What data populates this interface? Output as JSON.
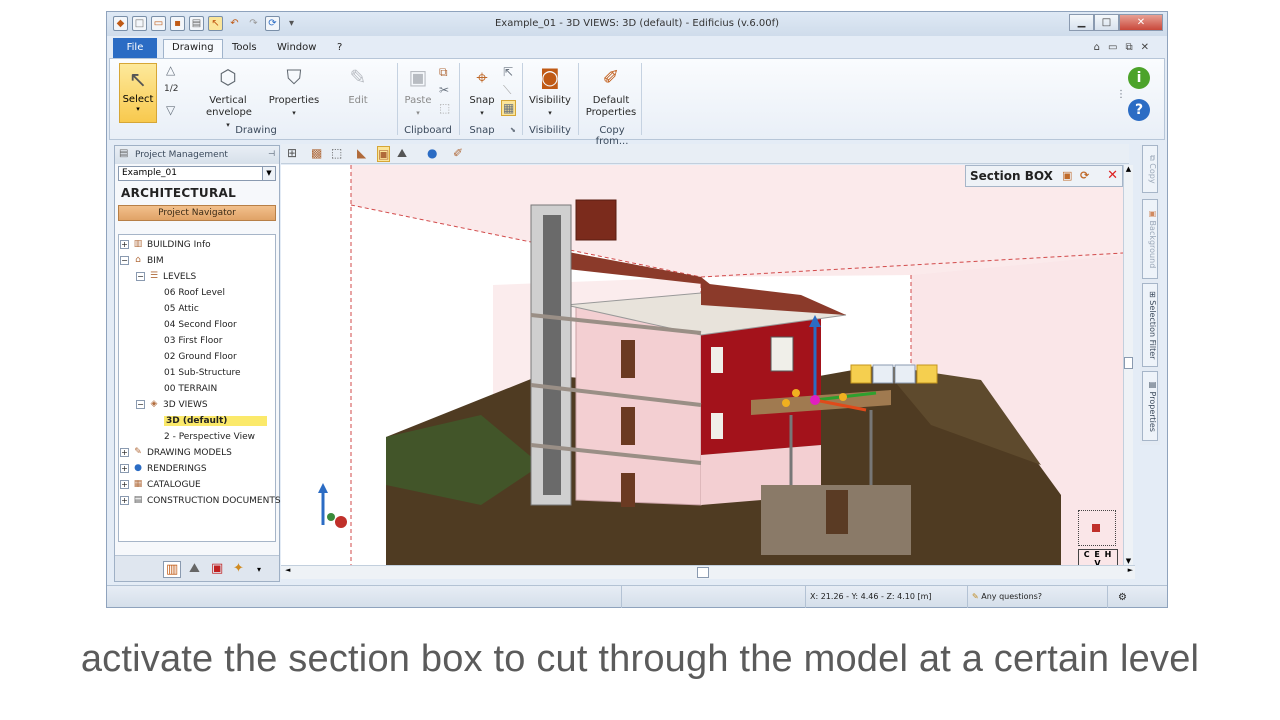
{
  "window": {
    "title": "Example_01 - 3D VIEWS: 3D (default) - Edificius (v.6.00f)"
  },
  "tabs": [
    {
      "label": "File"
    },
    {
      "label": "Drawing"
    },
    {
      "label": "Tools"
    },
    {
      "label": "Window"
    },
    {
      "label": "?"
    }
  ],
  "ribbon": {
    "select_label": "Select",
    "half_label": "1/2",
    "vertical_envelope_line1": "Vertical",
    "vertical_envelope_line2": "envelope",
    "properties_label": "Properties",
    "edit_label": "Edit",
    "paste_label": "Paste",
    "snap_label": "Snap",
    "visibility_label": "Visibility",
    "default_properties_line1": "Default",
    "default_properties_line2": "Properties",
    "groups": {
      "drawing": "Drawing",
      "clipboard": "Clipboard",
      "snap": "Snap",
      "visibility": "Visibility",
      "copy_from": "Copy from..."
    }
  },
  "left_panel": {
    "header": "Project Management",
    "project_dropdown": "Example_01",
    "section_title": "ARCHITECTURAL",
    "navigator_label": "Project Navigator",
    "tree": [
      {
        "label": "BUILDING Info"
      },
      {
        "label": "BIM"
      },
      {
        "label": "LEVELS"
      },
      {
        "label": "06 Roof Level"
      },
      {
        "label": "05 Attic"
      },
      {
        "label": "04 Second Floor"
      },
      {
        "label": "03 First Floor"
      },
      {
        "label": "02 Ground Floor"
      },
      {
        "label": "01 Sub-Structure"
      },
      {
        "label": "00 TERRAIN"
      },
      {
        "label": "3D VIEWS"
      },
      {
        "label": "3D (default)"
      },
      {
        "label": "2 - Perspective View"
      },
      {
        "label": "DRAWING MODELS"
      },
      {
        "label": "RENDERINGS"
      },
      {
        "label": "CATALOGUE"
      },
      {
        "label": "CONSTRUCTION DOCUMENTS"
      }
    ]
  },
  "viewport": {
    "section_box_label": "Section BOX",
    "view_cube_labels": "C E H V"
  },
  "right_tabs": [
    {
      "label": "Copy"
    },
    {
      "label": "Background"
    },
    {
      "label": "Selection Filter"
    },
    {
      "label": "Properties"
    }
  ],
  "status": {
    "coordinates": "X: 21.26 - Y: 4.46 - Z: 4.10 [m]",
    "help": "Any questions?"
  },
  "caption": "activate the section box to cut through the model at a certain level",
  "colors": {
    "accent": "#2b6cc4",
    "selected": "#fbe96a",
    "navigator": "#e0a367",
    "section_box": "#f4c2c2",
    "wall_red": "#a3121b",
    "wall_pink": "#f3cfd2"
  }
}
